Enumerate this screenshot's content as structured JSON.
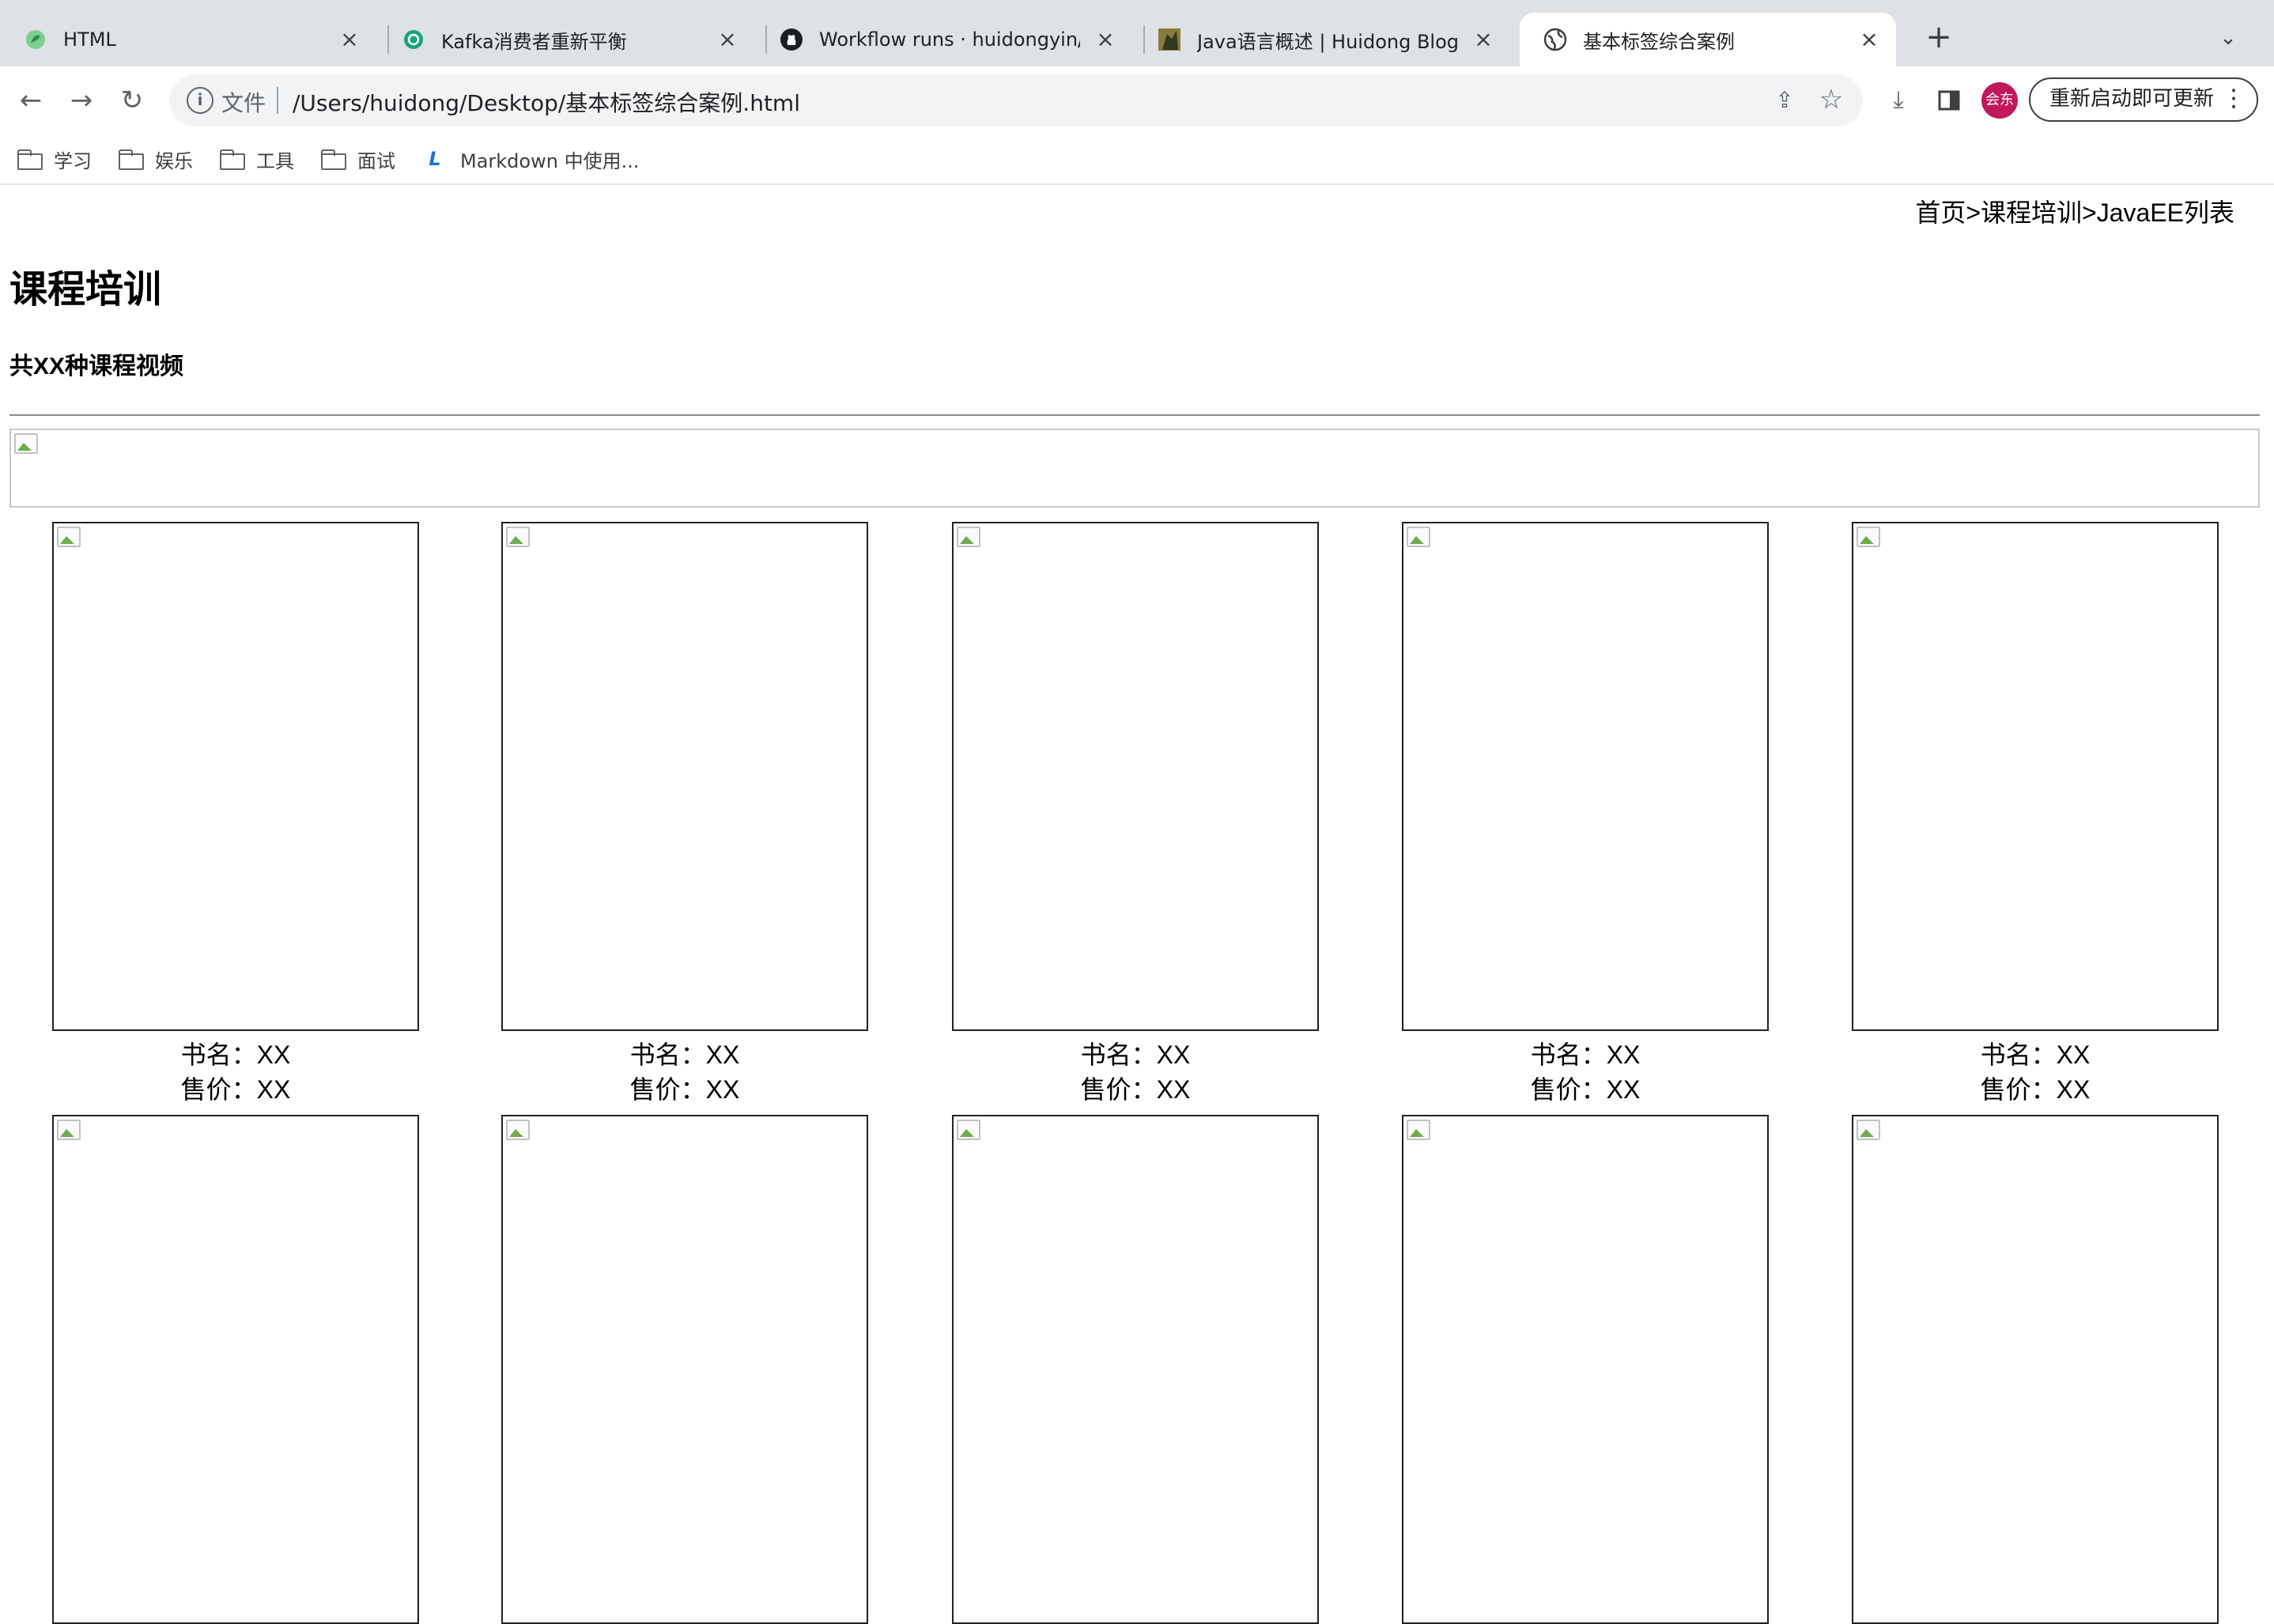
{
  "browser": {
    "tabs": [
      {
        "title": "HTML",
        "icon": "html-favicon",
        "active": false
      },
      {
        "title": "Kafka消费者重新平衡",
        "icon": "chatgpt-favicon",
        "active": false
      },
      {
        "title": "Workflow runs · huidongyin/hu",
        "icon": "github-favicon",
        "active": false
      },
      {
        "title": "Java语言概述 | Huidong Blogs",
        "icon": "blog-favicon",
        "active": false
      },
      {
        "title": "基本标签综合案例",
        "icon": "globe-favicon",
        "active": true
      }
    ],
    "new_tab_label": "+",
    "tab_search_label": "⌄",
    "address_scheme": "文件",
    "address_url": "/Users/huidong/Desktop/基本标签综合案例.html",
    "avatar_label": "会东",
    "update_button_label": "重新启动即可更新",
    "bookmarks": [
      {
        "label": "学习",
        "type": "folder"
      },
      {
        "label": "娱乐",
        "type": "folder"
      },
      {
        "label": "工具",
        "type": "folder"
      },
      {
        "label": "面试",
        "type": "folder"
      },
      {
        "label": "Markdown 中使用...",
        "type": "link"
      }
    ]
  },
  "page": {
    "breadcrumb": "首页>课程培训>JavaEE列表",
    "title": "课程培训",
    "subtitle": "共XX种课程视频",
    "cards": [
      {
        "name": "书名：XX",
        "price": "售价：XX"
      },
      {
        "name": "书名：XX",
        "price": "售价：XX"
      },
      {
        "name": "书名：XX",
        "price": "售价：XX"
      },
      {
        "name": "书名：XX",
        "price": "售价：XX"
      },
      {
        "name": "书名：XX",
        "price": "售价：XX"
      },
      {
        "name": "",
        "price": ""
      },
      {
        "name": "",
        "price": ""
      },
      {
        "name": "",
        "price": ""
      },
      {
        "name": "",
        "price": ""
      },
      {
        "name": "",
        "price": ""
      }
    ]
  },
  "colors": {
    "tabstrip_bg": "#dee1e6",
    "avatar_bg": "#c2185b",
    "omnibox_bg": "#f1f3f4"
  }
}
